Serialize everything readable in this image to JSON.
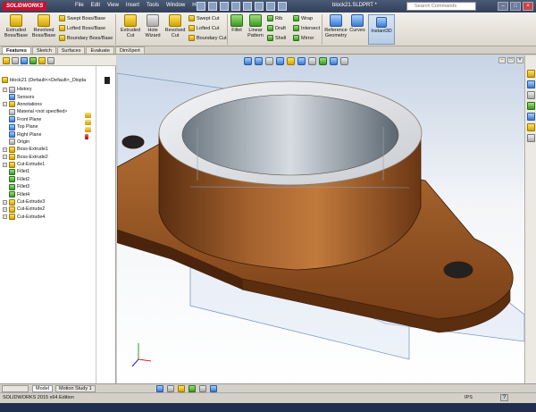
{
  "app": {
    "logo": "SOLIDWORKS",
    "document_title": "block21.SLDPRT *"
  },
  "menu": [
    "File",
    "Edit",
    "View",
    "Insert",
    "Tools",
    "Window",
    "Help"
  ],
  "search": {
    "placeholder": "Search Commands"
  },
  "window_buttons": [
    "–",
    "□",
    "×"
  ],
  "commands": {
    "extruded_boss": [
      "Extruded",
      "Boss/Base"
    ],
    "revolved_boss": [
      "Revolved",
      "Boss/Base"
    ],
    "swept_boss": "Swept Boss/Base",
    "lofted_boss": "Lofted Boss/Base",
    "boundary_boss": "Boundary Boss/Base",
    "extruded_cut": [
      "Extruded",
      "Cut"
    ],
    "hole_wizard": [
      "Hole",
      "Wizard"
    ],
    "revolved_cut": [
      "Revolved",
      "Cut"
    ],
    "swept_cut": "Swept Cut",
    "lofted_cut": "Lofted Cut",
    "boundary_cut": "Boundary Cut",
    "fillet": "Fillet",
    "linear_pattern": [
      "Linear",
      "Pattern"
    ],
    "rib": "Rib",
    "draft": "Draft",
    "shell": "Shell",
    "wrap": "Wrap",
    "intersect": "Intersect",
    "mirror": "Mirror",
    "reference_geometry": [
      "Reference",
      "Geometry"
    ],
    "curves": "Curves",
    "instant3d": "Instant3D"
  },
  "tabs": [
    "Features",
    "Sketch",
    "Surfaces",
    "Evaluate",
    "DimXpert"
  ],
  "active_tab": "Features",
  "tree": {
    "root": "block21  (Default<<Default>_Displa",
    "items": [
      {
        "label": "History",
        "expand": true,
        "icon": "history-icon"
      },
      {
        "label": "Sensors",
        "expand": false,
        "icon": "sensor-icon"
      },
      {
        "label": "Annotations",
        "expand": true,
        "icon": "annotation-icon"
      },
      {
        "label": "Material <not specified>",
        "expand": false,
        "icon": "material-icon"
      },
      {
        "label": "Front Plane",
        "expand": false,
        "icon": "plane-icon"
      },
      {
        "label": "Top Plane",
        "expand": false,
        "icon": "plane-icon"
      },
      {
        "label": "Right Plane",
        "expand": false,
        "icon": "plane-icon"
      },
      {
        "label": "Origin",
        "expand": false,
        "icon": "origin-icon"
      },
      {
        "label": "Boss-Extrude1",
        "expand": true,
        "icon": "boss-extrude-icon"
      },
      {
        "label": "Boss-Extrude2",
        "expand": true,
        "icon": "boss-extrude-icon"
      },
      {
        "label": "Cut-Extrude1",
        "expand": true,
        "icon": "cut-extrude-icon"
      },
      {
        "label": "Fillet1",
        "expand": false,
        "icon": "fillet-icon"
      },
      {
        "label": "Fillet2",
        "expand": false,
        "icon": "fillet-icon"
      },
      {
        "label": "Fillet3",
        "expand": false,
        "icon": "fillet-icon"
      },
      {
        "label": "Fillet4",
        "expand": false,
        "icon": "fillet-icon"
      },
      {
        "label": "Cut-Extrude3",
        "expand": true,
        "icon": "cut-extrude-icon"
      },
      {
        "label": "Cut-Extrude2",
        "expand": true,
        "icon": "cut-extrude-icon"
      },
      {
        "label": "Cut-Extrude4",
        "expand": true,
        "icon": "cut-extrude-icon"
      }
    ]
  },
  "bottom_tabs": [
    "Model",
    "Motion Study 1"
  ],
  "active_bottom_tab": "Model",
  "status": {
    "edition": "SOLIDWORKS 2015 x64 Edition",
    "units": "IPS",
    "help": "?"
  },
  "colors": {
    "part": "#8a4e22",
    "accent": "#c8102e",
    "plane": "#9fb7d8"
  }
}
